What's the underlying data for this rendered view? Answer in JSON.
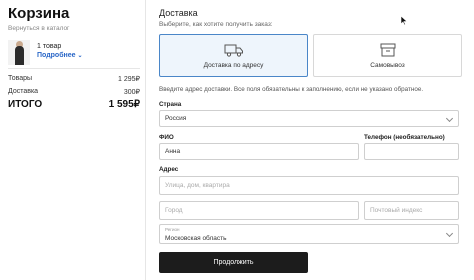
{
  "cart": {
    "title": "Корзина",
    "back_link": "Вернуться в каталог",
    "item_count": "1 товар",
    "details_link": "Подробнее",
    "goods_label": "Товары",
    "goods_value": "1 295₽",
    "delivery_label": "Доставка",
    "delivery_value": "300₽",
    "total_label": "ИТОГО",
    "total_value": "1 595₽"
  },
  "delivery": {
    "title": "Доставка",
    "choose_hint": "Выберите, как хотите получить заказ:",
    "options": [
      {
        "label": "Доставка по адресу",
        "icon": "truck-icon",
        "selected": true
      },
      {
        "label": "Самовывоз",
        "icon": "box-icon",
        "selected": false
      }
    ],
    "address_hint": "Введите адрес доставки. Все поля обязательны к заполнению, если не указано обратное."
  },
  "form": {
    "country_label": "Страна",
    "country_value": "Россия",
    "name_label": "ФИО",
    "name_value": "Анна",
    "phone_label": "Телефон (необязательно)",
    "phone_value": "",
    "address_label": "Адрес",
    "street_placeholder": "Улица, дом, квартира",
    "city_placeholder": "Город",
    "postal_placeholder": "Почтовый индекс",
    "region_small_label": "Регион",
    "region_value": "Московская область",
    "submit_label": "Продолжить"
  },
  "colors": {
    "accent": "#2966c7",
    "selected_border": "#4a86c8",
    "selected_bg": "#eef5fc",
    "button_bg": "#1c1c1c"
  }
}
